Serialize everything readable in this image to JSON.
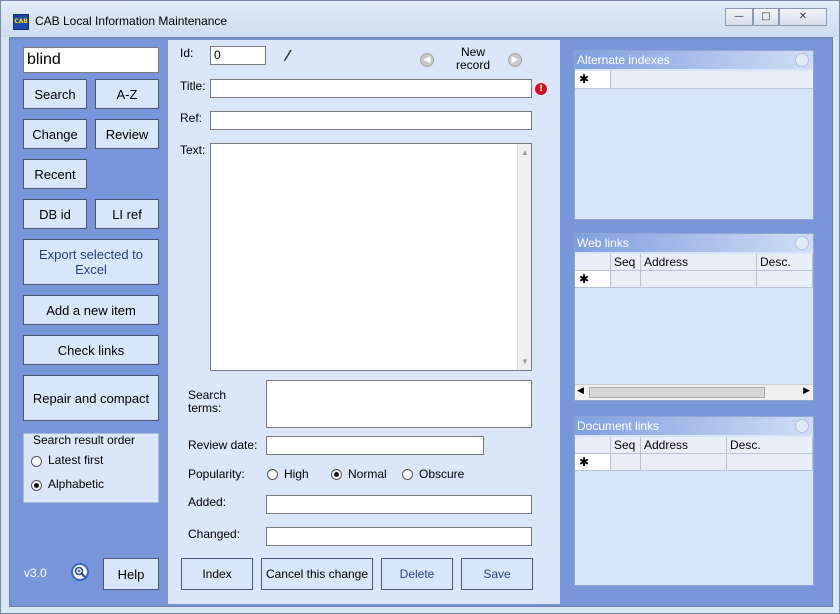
{
  "window": {
    "title": "CAB Local Information Maintenance",
    "icon_text": "CAB",
    "min": "—",
    "max": "□",
    "close": "✕"
  },
  "left": {
    "search_value": "blind",
    "buttons": {
      "search": "Search",
      "az": "A-Z",
      "change": "Change",
      "review": "Review",
      "recent": "Recent",
      "dbid": "DB id",
      "liref": "LI ref",
      "export": "Export selected to Excel",
      "add": "Add a new item",
      "check": "Check links",
      "repair": "Repair and compact",
      "help": "Help"
    },
    "order": {
      "title": "Search result order",
      "latest": "Latest first",
      "alpha": "Alphabetic",
      "selected": "Alphabetic"
    },
    "version": "v3.0"
  },
  "form": {
    "id_label": "Id:",
    "id_value": "0",
    "new_record": "New record",
    "title_label": "Title:",
    "title_value": "",
    "ref_label": "Ref:",
    "ref_value": "",
    "text_label": "Text:",
    "text_value": "",
    "search_terms_label": "Search terms:",
    "review_date_label": "Review date:",
    "popularity_label": "Popularity:",
    "pop_high": "High",
    "pop_normal": "Normal",
    "pop_obscure": "Obscure",
    "pop_selected": "Normal",
    "added_label": "Added:",
    "changed_label": "Changed:",
    "btn_index": "Index",
    "btn_cancel": "Cancel this change",
    "btn_delete": "Delete",
    "btn_save": "Save"
  },
  "right": {
    "alt": {
      "title": "Alternate indexes",
      "new_row": "✱"
    },
    "web": {
      "title": "Web links",
      "cols": [
        "Seq",
        "Address",
        "Desc."
      ],
      "new_row": "✱"
    },
    "doc": {
      "title": "Document links",
      "cols": [
        "Seq",
        "Address",
        "Desc."
      ],
      "new_row": "✱"
    }
  }
}
